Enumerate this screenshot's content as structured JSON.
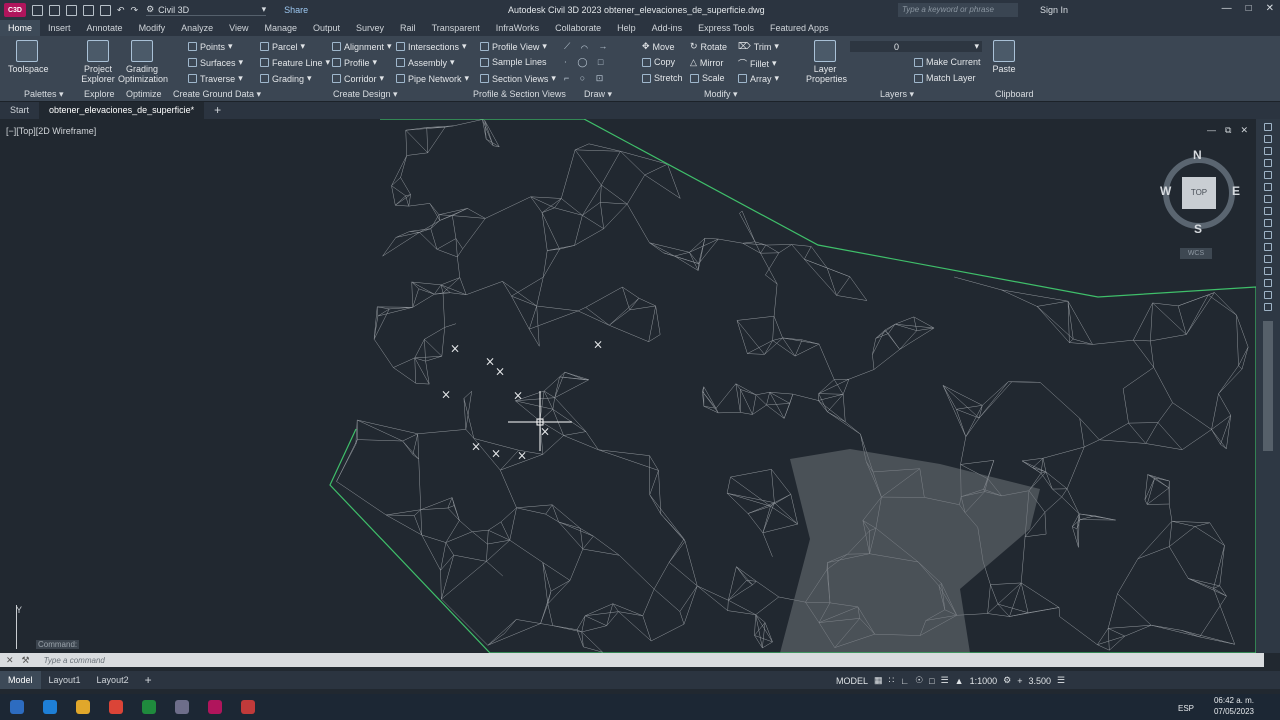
{
  "app": {
    "title": "Autodesk Civil 3D 2023   obtener_elevaciones_de_superficie.dwg",
    "workspace": "Civil 3D",
    "share": "Share",
    "search_placeholder": "Type a keyword or phrase",
    "sign_in": "Sign In",
    "logo": "C3D"
  },
  "menu_tabs": [
    "Home",
    "Insert",
    "Annotate",
    "Modify",
    "Analyze",
    "View",
    "Manage",
    "Output",
    "Survey",
    "Rail",
    "Transparent",
    "InfraWorks",
    "Collaborate",
    "Help",
    "Add-ins",
    "Express Tools",
    "Featured Apps"
  ],
  "ribbon": {
    "toolspace": "Toolspace",
    "project_explorer": [
      "Project",
      "Explorer"
    ],
    "grading_optimization": [
      "Grading",
      "Optimization"
    ],
    "points": "Points",
    "surfaces": "Surfaces",
    "traverse": "Traverse",
    "parcel": "Parcel",
    "feature_line": "Feature Line",
    "grading": "Grading",
    "alignment": "Alignment",
    "profile": "Profile",
    "corridor": "Corridor",
    "intersections": "Intersections",
    "assembly": "Assembly",
    "pipe_network": "Pipe Network",
    "profile_view": "Profile View",
    "sample_lines": "Sample Lines",
    "section_views": "Section Views",
    "move": "Move",
    "rotate": "Rotate",
    "trim": "Trim",
    "copy": "Copy",
    "mirror": "Mirror",
    "fillet": "Fillet",
    "stretch": "Stretch",
    "scale": "Scale",
    "array": "Array",
    "layer_properties": [
      "Layer",
      "Properties"
    ],
    "layer_value": "0",
    "make_current": "Make Current",
    "match_layer": "Match Layer",
    "paste": "Paste",
    "panels": {
      "palettes": "Palettes",
      "explore": "Explore",
      "optimize": "Optimize",
      "create_ground_data": "Create Ground Data",
      "create_design": "Create Design",
      "profile_section_views": "Profile & Section Views",
      "draw": "Draw",
      "modify": "Modify",
      "layers": "Layers",
      "clipboard": "Clipboard"
    }
  },
  "doc_tabs": [
    "Start",
    "obtener_elevaciones_de_superficie*"
  ],
  "viewport": {
    "label": "[−][Top][2D Wireframe]",
    "compass": {
      "n": "N",
      "s": "S",
      "e": "E",
      "w": "W",
      "cube": "TOP",
      "wcs": "WCS"
    },
    "ucs_y": "Y"
  },
  "command": {
    "history": "Command:",
    "placeholder": "Type a command"
  },
  "layout_tabs": [
    "Model",
    "Layout1",
    "Layout2"
  ],
  "status": {
    "model": "MODEL",
    "scale": "1:1000",
    "value": "3.500"
  },
  "tray": {
    "time": "06:42 a. m.",
    "date": "07/05/2023",
    "lang": "ESP"
  },
  "colors": {
    "boundary": "#3fbf6a",
    "mesh": "#b9bec3",
    "canvas": "#212830",
    "ribbon": "#3b4653"
  }
}
